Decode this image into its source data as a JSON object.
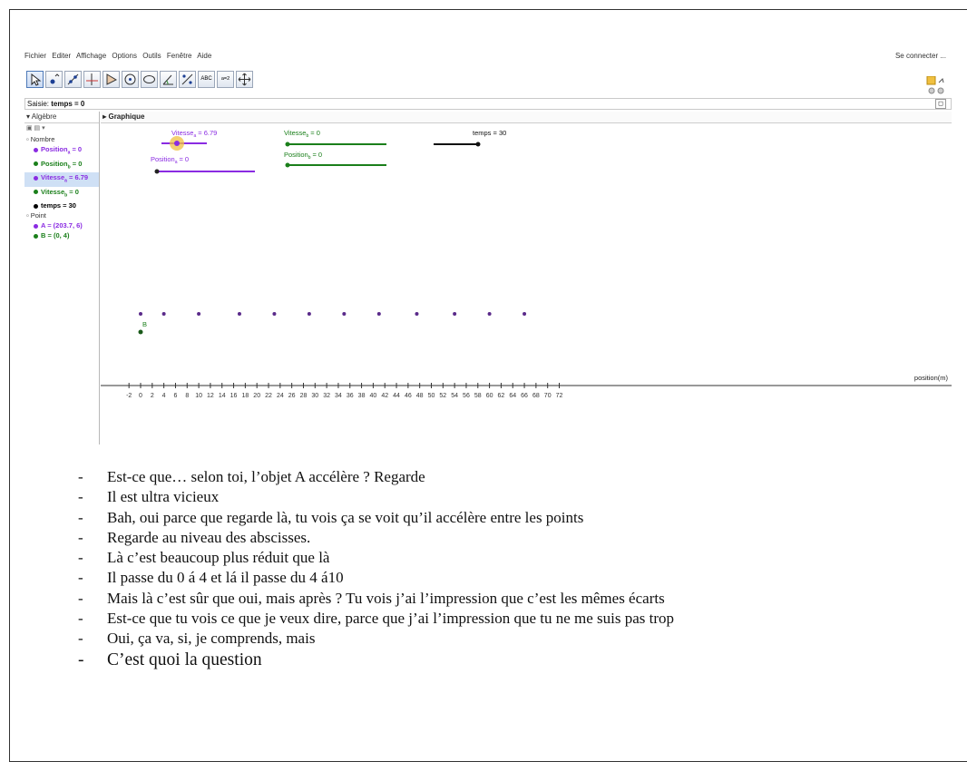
{
  "menubar": {
    "items": [
      "Fichier",
      "Editer",
      "Affichage",
      "Options",
      "Outils",
      "Fenêtre",
      "Aide"
    ],
    "connect": "Se connecter ..."
  },
  "toolbar": {
    "tools": [
      "move-tool",
      "point-tool",
      "line-tool",
      "perpendicular-tool",
      "polygon-tool",
      "circle-tool",
      "conic-tool",
      "angle-tool",
      "reflect-tool",
      "text-tool",
      "slider-tool",
      "move-view-tool"
    ],
    "text_tool_label": "ABC",
    "slider_tool_label": "a=2"
  },
  "input_bar": {
    "label": "Saisie:",
    "value": "temps = 0"
  },
  "algebra": {
    "title": "Algèbre",
    "groups": [
      {
        "name": "Nombre",
        "items": [
          {
            "text": "Position",
            "sub": "a",
            "val": "= 0",
            "color": "#8a2be2"
          },
          {
            "text": "Position",
            "sub": "b",
            "val": "= 0",
            "color": "#1a7f1a"
          },
          {
            "text": "Vitesse",
            "sub": "a",
            "val": "= 6.79",
            "color": "#8a2be2"
          },
          {
            "text": "Vitesse",
            "sub": "b",
            "val": "= 0",
            "color": "#1a7f1a"
          },
          {
            "text": "temps = 30",
            "sub": "",
            "val": "",
            "color": "#000000"
          }
        ]
      },
      {
        "name": "Point",
        "items": [
          {
            "text": "A = (203.7, 6)",
            "sub": "",
            "val": "",
            "color": "#8a2be2"
          },
          {
            "text": "B = (0, 4)",
            "sub": "",
            "val": "",
            "color": "#1a7f1a"
          }
        ]
      }
    ]
  },
  "graphics": {
    "title": "Graphique",
    "axis_label": "position(m)",
    "ticks": [
      "-2",
      "0",
      "2",
      "4",
      "6",
      "8",
      "10",
      "12",
      "14",
      "16",
      "18",
      "20",
      "22",
      "24",
      "26",
      "28",
      "30",
      "32",
      "34",
      "36",
      "38",
      "40",
      "42",
      "44",
      "46",
      "48",
      "50",
      "52",
      "54",
      "56",
      "58",
      "60",
      "62",
      "64",
      "66",
      "68",
      "70",
      "72"
    ],
    "sliders": [
      {
        "name": "Vitesse",
        "sub": "a",
        "val": "= 6.79",
        "color": "#8a2be2"
      },
      {
        "name": "Position",
        "sub": "a",
        "val": "= 0",
        "color": "#8a2be2"
      },
      {
        "name": "Vitesse",
        "sub": "b",
        "val": "= 0",
        "color": "#1a7f1a"
      },
      {
        "name": "Position",
        "sub": "b",
        "val": "= 0",
        "color": "#1a7f1a"
      },
      {
        "name": "temps = 30",
        "sub": "",
        "val": "",
        "color": "#000000"
      }
    ],
    "point_label": "B"
  },
  "transcript": [
    "Est-ce que… selon toi, l’objet A accélère ? Regarde",
    "Il est ultra vicieux",
    "Bah, oui parce que regarde là, tu vois ça se voit qu’il accélère entre les points",
    "Regarde au niveau des abscisses.",
    "Là c’est beaucoup plus réduit que là",
    "Il passe du 0 á 4 et lá il passe du 4 á10",
    "Mais là c’est sûr que oui, mais après ? Tu vois j’ai l’impression que c’est les mêmes écarts",
    "Est-ce que tu vois ce que je veux dire, parce que j’ai l’impression que tu ne me suis pas trop",
    "Oui, ça va, si, je comprends, mais",
    "C’est quoi la question"
  ],
  "dash": "-"
}
